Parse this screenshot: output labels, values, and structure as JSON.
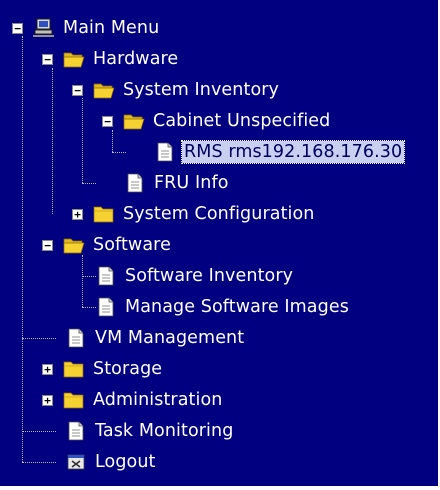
{
  "tree": {
    "root": {
      "label": "Main Menu",
      "icon": "computer-icon",
      "expanded": true
    },
    "items": [
      {
        "id": "hardware",
        "label": "Hardware",
        "icon": "folder-open-icon",
        "expanded": true
      },
      {
        "id": "system-inventory",
        "label": "System Inventory",
        "icon": "folder-open-icon",
        "expanded": true
      },
      {
        "id": "cabinet-unspecified",
        "label": "Cabinet Unspecified",
        "icon": "folder-open-icon",
        "expanded": true
      },
      {
        "id": "rms",
        "label": "RMS rms192.168.176.30",
        "icon": "document-icon",
        "selected": true
      },
      {
        "id": "fru-info",
        "label": "FRU Info",
        "icon": "document-icon"
      },
      {
        "id": "system-configuration",
        "label": "System Configuration",
        "icon": "folder-closed-icon",
        "expanded": false
      },
      {
        "id": "software",
        "label": "Software",
        "icon": "folder-open-icon",
        "expanded": true
      },
      {
        "id": "software-inventory",
        "label": "Software Inventory",
        "icon": "document-icon"
      },
      {
        "id": "manage-software-images",
        "label": "Manage Software Images",
        "icon": "document-icon"
      },
      {
        "id": "vm-management",
        "label": "VM Management",
        "icon": "document-icon"
      },
      {
        "id": "storage",
        "label": "Storage",
        "icon": "folder-closed-icon",
        "expanded": false
      },
      {
        "id": "administration",
        "label": "Administration",
        "icon": "folder-closed-icon",
        "expanded": false
      },
      {
        "id": "task-monitoring",
        "label": "Task Monitoring",
        "icon": "document-icon"
      },
      {
        "id": "logout",
        "label": "Logout",
        "icon": "logout-icon"
      }
    ]
  },
  "colors": {
    "background": "#000080",
    "selection": "#c9cfef",
    "folder": "#f5d232"
  }
}
